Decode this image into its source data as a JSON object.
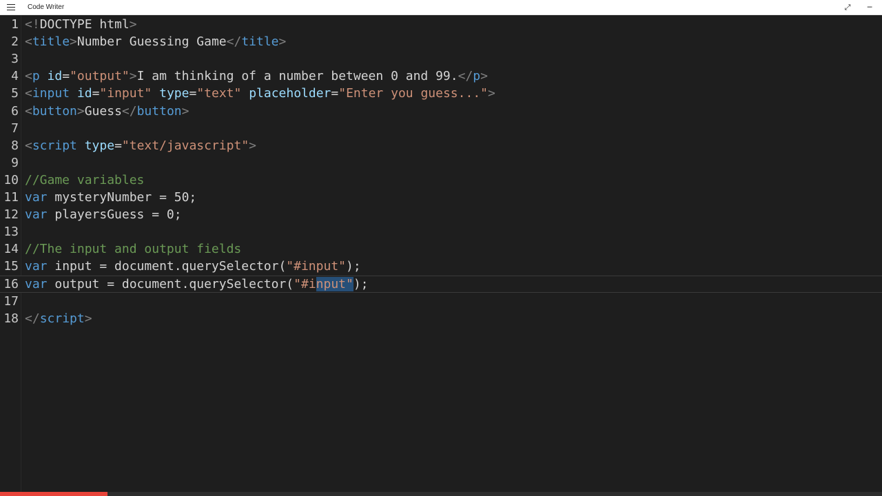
{
  "window": {
    "title": "Code Writer"
  },
  "colors": {
    "tag": "#569cd6",
    "attribute": "#9cdcfe",
    "string": "#ce9178",
    "comment": "#6a9955",
    "text": "#d4d4d4",
    "status_accent": "#e8443a"
  },
  "icons": {
    "menu": "hamburger-menu-icon",
    "expand": "expand-icon",
    "minimize": "minimize-icon"
  },
  "editor": {
    "current_line": 16,
    "lines": [
      {
        "number": "1",
        "tokens": [
          {
            "t": "br",
            "v": "<!"
          },
          {
            "t": "txt",
            "v": "DOCTYPE html"
          },
          {
            "t": "br",
            "v": ">"
          }
        ]
      },
      {
        "number": "2",
        "tokens": [
          {
            "t": "br",
            "v": "<"
          },
          {
            "t": "tag",
            "v": "title"
          },
          {
            "t": "br",
            "v": ">"
          },
          {
            "t": "txt",
            "v": "Number Guessing Game"
          },
          {
            "t": "br",
            "v": "</"
          },
          {
            "t": "tag",
            "v": "title"
          },
          {
            "t": "br",
            "v": ">"
          }
        ]
      },
      {
        "number": "3",
        "tokens": []
      },
      {
        "number": "4",
        "tokens": [
          {
            "t": "br",
            "v": "<"
          },
          {
            "t": "tag",
            "v": "p"
          },
          {
            "t": "txt",
            "v": " "
          },
          {
            "t": "attr",
            "v": "id"
          },
          {
            "t": "txt",
            "v": "="
          },
          {
            "t": "str",
            "v": "\"output\""
          },
          {
            "t": "br",
            "v": ">"
          },
          {
            "t": "txt",
            "v": "I am thinking of a number between 0 and 99."
          },
          {
            "t": "br",
            "v": "</"
          },
          {
            "t": "tag",
            "v": "p"
          },
          {
            "t": "br",
            "v": ">"
          }
        ]
      },
      {
        "number": "5",
        "tokens": [
          {
            "t": "br",
            "v": "<"
          },
          {
            "t": "tag",
            "v": "input"
          },
          {
            "t": "txt",
            "v": " "
          },
          {
            "t": "attr",
            "v": "id"
          },
          {
            "t": "txt",
            "v": "="
          },
          {
            "t": "str",
            "v": "\"input\""
          },
          {
            "t": "txt",
            "v": " "
          },
          {
            "t": "attr",
            "v": "type"
          },
          {
            "t": "txt",
            "v": "="
          },
          {
            "t": "str",
            "v": "\"text\""
          },
          {
            "t": "txt",
            "v": " "
          },
          {
            "t": "attr",
            "v": "placeholder"
          },
          {
            "t": "txt",
            "v": "="
          },
          {
            "t": "str",
            "v": "\"Enter you guess...\""
          },
          {
            "t": "br",
            "v": ">"
          }
        ]
      },
      {
        "number": "6",
        "tokens": [
          {
            "t": "br",
            "v": "<"
          },
          {
            "t": "tag",
            "v": "button"
          },
          {
            "t": "br",
            "v": ">"
          },
          {
            "t": "txt",
            "v": "Guess"
          },
          {
            "t": "br",
            "v": "</"
          },
          {
            "t": "tag",
            "v": "button"
          },
          {
            "t": "br",
            "v": ">"
          }
        ]
      },
      {
        "number": "7",
        "tokens": []
      },
      {
        "number": "8",
        "tokens": [
          {
            "t": "br",
            "v": "<"
          },
          {
            "t": "tag",
            "v": "script"
          },
          {
            "t": "txt",
            "v": " "
          },
          {
            "t": "attr",
            "v": "type"
          },
          {
            "t": "txt",
            "v": "="
          },
          {
            "t": "str",
            "v": "\"text/javascript\""
          },
          {
            "t": "br",
            "v": ">"
          }
        ]
      },
      {
        "number": "9",
        "tokens": []
      },
      {
        "number": "10",
        "tokens": [
          {
            "t": "cm",
            "v": "//Game variables"
          }
        ]
      },
      {
        "number": "11",
        "tokens": [
          {
            "t": "kw",
            "v": "var"
          },
          {
            "t": "txt",
            "v": " mysteryNumber = 50;"
          }
        ]
      },
      {
        "number": "12",
        "tokens": [
          {
            "t": "kw",
            "v": "var"
          },
          {
            "t": "txt",
            "v": " playersGuess = 0;"
          }
        ]
      },
      {
        "number": "13",
        "tokens": []
      },
      {
        "number": "14",
        "tokens": [
          {
            "t": "cm",
            "v": "//The input and output fields"
          }
        ]
      },
      {
        "number": "15",
        "tokens": [
          {
            "t": "kw",
            "v": "var"
          },
          {
            "t": "txt",
            "v": " input = document.querySelector("
          },
          {
            "t": "str",
            "v": "\"#input\""
          },
          {
            "t": "txt",
            "v": ");"
          }
        ]
      },
      {
        "number": "16",
        "tokens": [
          {
            "t": "kw",
            "v": "var"
          },
          {
            "t": "txt",
            "v": " output = document.querySelector("
          },
          {
            "t": "str",
            "v": "\"#i"
          },
          {
            "t": "caret",
            "v": ""
          },
          {
            "t": "str-sel",
            "v": "nput\""
          },
          {
            "t": "txt",
            "v": ");"
          }
        ]
      },
      {
        "number": "17",
        "tokens": []
      },
      {
        "number": "18",
        "tokens": [
          {
            "t": "br",
            "v": "</"
          },
          {
            "t": "tag",
            "v": "script"
          },
          {
            "t": "br",
            "v": ">"
          }
        ]
      }
    ]
  }
}
